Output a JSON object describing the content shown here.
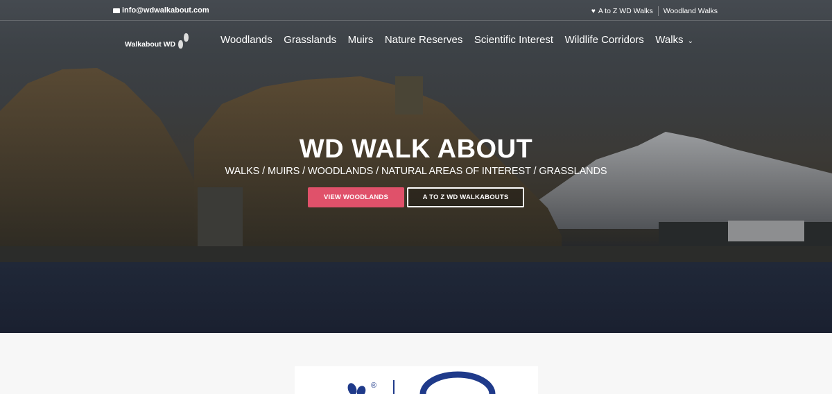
{
  "topbar": {
    "email": "info@wdwalkabout.com",
    "links": [
      "A to Z WD Walks",
      "Woodland Walks"
    ]
  },
  "logo": {
    "text": "Walkabout WD"
  },
  "nav": {
    "items": [
      "Woodlands",
      "Grasslands",
      "Muirs",
      "Nature Reserves",
      "Scientific Interest",
      "Wildlife Corridors",
      "Walks"
    ],
    "dropdown_indicator": "⌄"
  },
  "hero": {
    "title": "WD WALK ABOUT",
    "subtitle": "WALKS / MUIRS / WOODLANDS / NATURAL AREAS OF INTEREST / GRASSLANDS",
    "primary_button": "VIEW WOODLANDS",
    "secondary_button": "A TO Z WD WALKABOUTS"
  },
  "colors": {
    "accent": "#e0516a",
    "logo_partner_blue": "#1f3a8a"
  },
  "partner_logo": {
    "registered_mark": "®"
  }
}
